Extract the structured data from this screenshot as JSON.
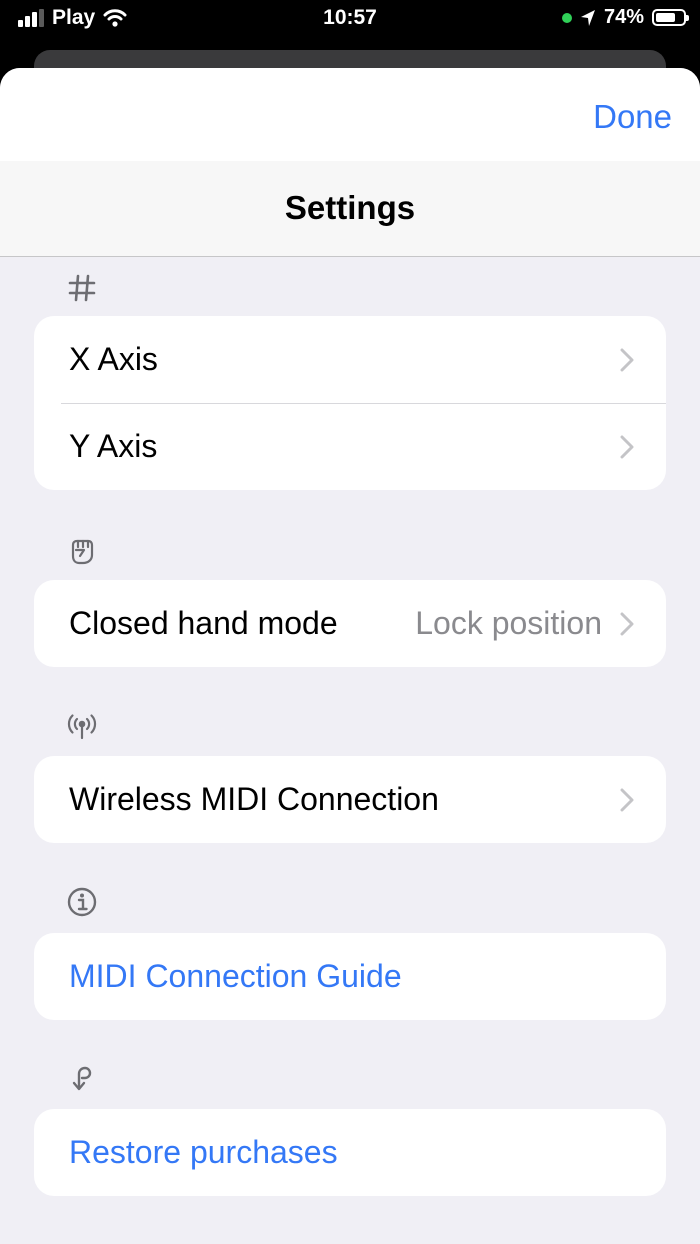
{
  "status_bar": {
    "carrier": "Play",
    "time": "10:57",
    "battery": "74%",
    "battery_level": 0.74
  },
  "sheet": {
    "done_label": "Done",
    "title": "Settings"
  },
  "sections": {
    "axes": {
      "icon": "number-sign-icon",
      "x_axis": "X Axis",
      "y_axis": "Y Axis"
    },
    "hand": {
      "icon": "closed-hand-icon",
      "label": "Closed hand mode",
      "value": "Lock position"
    },
    "midi": {
      "icon": "antenna-icon",
      "label": "Wireless MIDI Connection"
    },
    "info": {
      "icon": "info-circle-icon",
      "label": "MIDI Connection Guide"
    },
    "restore": {
      "icon": "restore-arrow-icon",
      "label": "Restore purchases"
    }
  },
  "colors": {
    "accent": "#3478f6",
    "background": "#f0eff5",
    "secondary_text": "#8a8a8e"
  }
}
